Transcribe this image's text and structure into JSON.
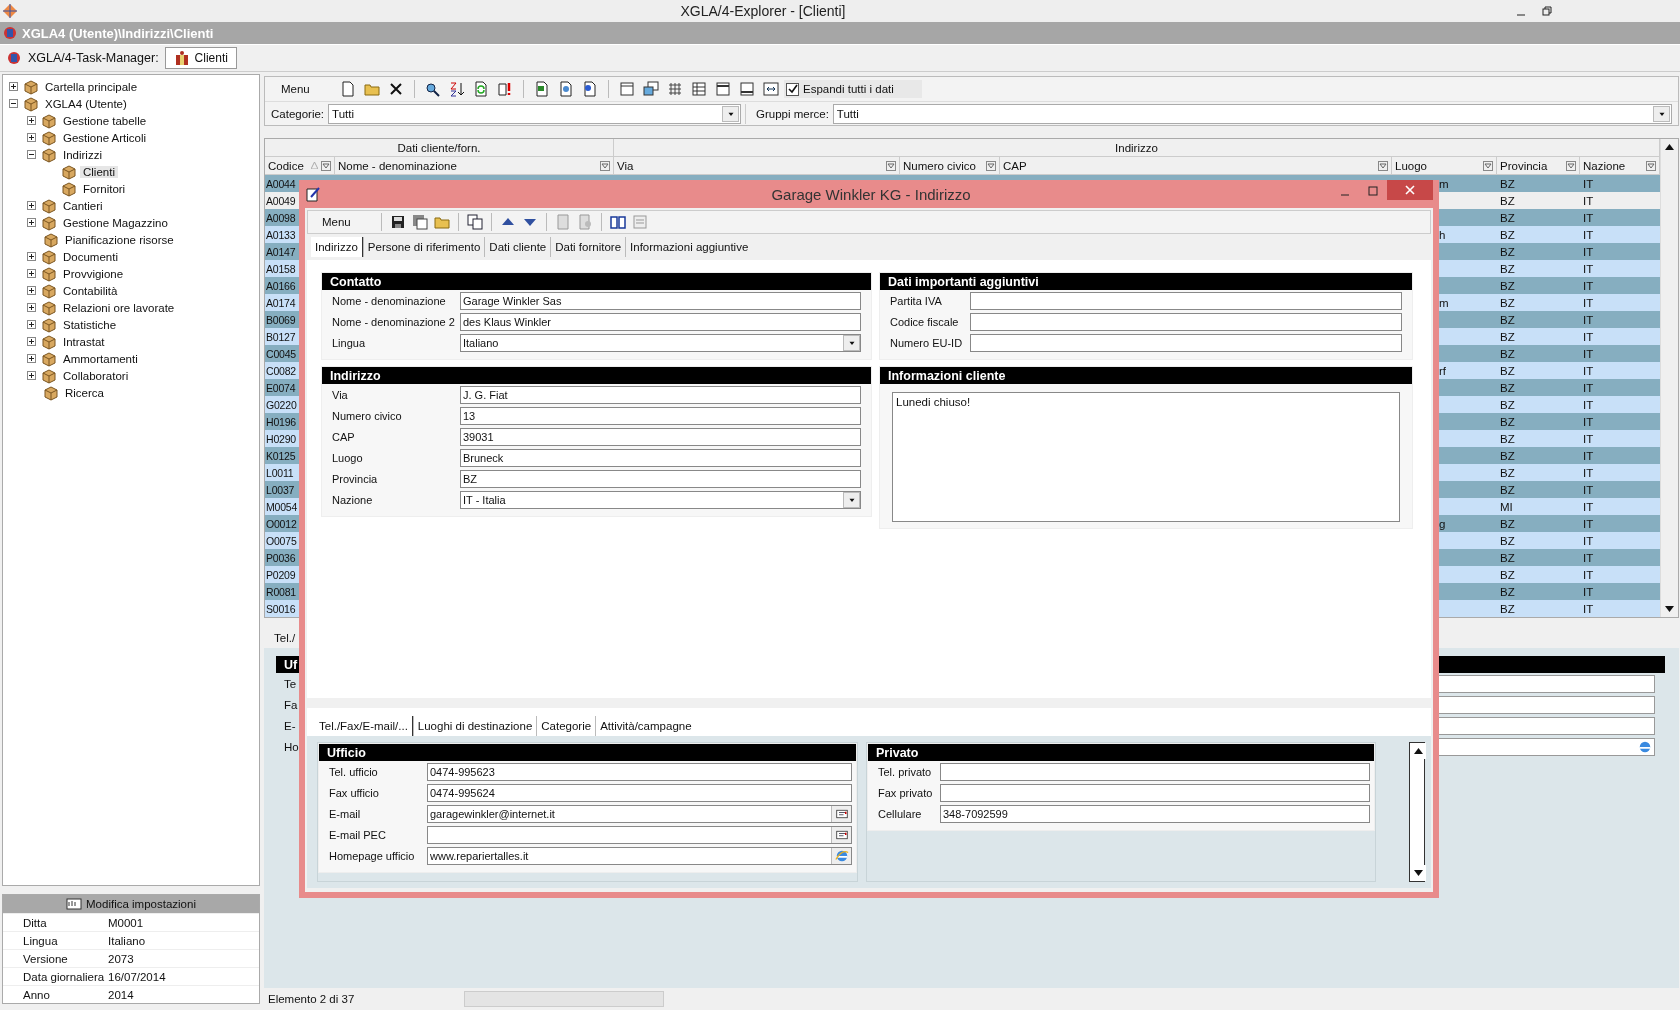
{
  "app_title": "XGLA/4-Explorer - [Clienti]",
  "breadcrumb": "XGLA4 (Utente)\\Indirizzi\\Clienti",
  "task_manager": {
    "label": "XGLA/4-Task-Manager:",
    "tabs": [
      {
        "label": "Clienti",
        "selected": true
      }
    ]
  },
  "tree": [
    {
      "label": "Cartella principale",
      "kind": "node",
      "expanded": false,
      "selected": false
    },
    {
      "label": "XGLA4 (Utente)",
      "kind": "node",
      "expanded": true,
      "selected": false,
      "children": [
        {
          "label": "Gestione tabelle",
          "kind": "node",
          "expanded": false,
          "selected": false
        },
        {
          "label": "Gestione Articoli",
          "kind": "node",
          "expanded": false,
          "selected": false
        },
        {
          "label": "Indirizzi",
          "kind": "node",
          "expanded": true,
          "selected": false,
          "children": [
            {
              "label": "Clienti",
              "kind": "leaf",
              "selected": true
            },
            {
              "label": "Fornitori",
              "kind": "leaf",
              "selected": false
            }
          ]
        },
        {
          "label": "Cantieri",
          "kind": "node",
          "expanded": false,
          "selected": false
        },
        {
          "label": "Gestione Magazzino",
          "kind": "node",
          "expanded": false,
          "selected": false
        },
        {
          "label": "Pianificazione risorse",
          "kind": "leaf",
          "selected": false
        },
        {
          "label": "Documenti",
          "kind": "node",
          "expanded": false,
          "selected": false
        },
        {
          "label": "Provvigione",
          "kind": "node",
          "expanded": false,
          "selected": false
        },
        {
          "label": "Contabilità",
          "kind": "node",
          "expanded": false,
          "selected": false
        },
        {
          "label": "Relazioni ore lavorate",
          "kind": "node",
          "expanded": false,
          "selected": false
        },
        {
          "label": "Statistiche",
          "kind": "node",
          "expanded": false,
          "selected": false
        },
        {
          "label": "Intrastat",
          "kind": "node",
          "expanded": false,
          "selected": false
        },
        {
          "label": "Ammortamenti",
          "kind": "node",
          "expanded": false,
          "selected": false
        },
        {
          "label": "Collaboratori",
          "kind": "node",
          "expanded": false,
          "selected": false
        },
        {
          "label": "Ricerca",
          "kind": "leaf",
          "selected": false
        }
      ]
    }
  ],
  "settings": {
    "title": "Modifica impostazioni",
    "rows": [
      {
        "label": "Ditta",
        "value": "M0001"
      },
      {
        "label": "Lingua",
        "value": "Italiano"
      },
      {
        "label": "Versione",
        "value": "2073"
      },
      {
        "label": "Data giornaliera",
        "value": "16/07/2014"
      },
      {
        "label": "Anno",
        "value": "2014"
      }
    ]
  },
  "toolbar": {
    "menu": "Menu",
    "expand_all": {
      "label": "Espandi tutti i dati",
      "checked": true
    }
  },
  "filters": [
    {
      "label": "Categorie:",
      "value": "Tutti"
    },
    {
      "label": "Gruppi merce:",
      "value": "Tutti"
    }
  ],
  "table": {
    "groups": [
      "Dati cliente/forn.",
      "Indirizzo"
    ],
    "columns": [
      "Codice",
      "Nome - denominazione",
      "Via",
      "Numero civico",
      "CAP",
      "Luogo",
      "Provincia",
      "Nazione"
    ],
    "rows": [
      {
        "code": "A0044",
        "luogo": "m",
        "provincia": "BZ",
        "nazione": "IT",
        "selected": false
      },
      {
        "code": "A0049",
        "provincia": "BZ",
        "nazione": "IT",
        "selected": true
      },
      {
        "code": "A0098",
        "provincia": "BZ",
        "nazione": "IT",
        "selected": false
      },
      {
        "code": "A0133",
        "luogo": "h",
        "provincia": "BZ",
        "nazione": "IT",
        "selected": false
      },
      {
        "code": "A0147",
        "provincia": "BZ",
        "nazione": "IT",
        "selected": false
      },
      {
        "code": "A0158",
        "provincia": "BZ",
        "nazione": "IT",
        "selected": false
      },
      {
        "code": "A0166",
        "provincia": "BZ",
        "nazione": "IT",
        "selected": false
      },
      {
        "code": "A0174",
        "luogo": "m",
        "provincia": "BZ",
        "nazione": "IT",
        "selected": false
      },
      {
        "code": "B0069",
        "provincia": "BZ",
        "nazione": "IT",
        "selected": false
      },
      {
        "code": "B0127",
        "provincia": "BZ",
        "nazione": "IT",
        "selected": false
      },
      {
        "code": "C0045",
        "provincia": "BZ",
        "nazione": "IT",
        "selected": false
      },
      {
        "code": "C0082",
        "luogo": "rf",
        "provincia": "BZ",
        "nazione": "IT",
        "selected": false
      },
      {
        "code": "E0074",
        "provincia": "BZ",
        "nazione": "IT",
        "selected": false
      },
      {
        "code": "G0220",
        "provincia": "BZ",
        "nazione": "IT",
        "selected": false
      },
      {
        "code": "H0196",
        "provincia": "BZ",
        "nazione": "IT",
        "selected": false
      },
      {
        "code": "H0290",
        "provincia": "BZ",
        "nazione": "IT",
        "selected": false
      },
      {
        "code": "K0125",
        "provincia": "BZ",
        "nazione": "IT",
        "selected": false
      },
      {
        "code": "L0011",
        "provincia": "BZ",
        "nazione": "IT",
        "selected": false
      },
      {
        "code": "L0037",
        "provincia": "BZ",
        "nazione": "IT",
        "selected": false
      },
      {
        "code": "M0054",
        "provincia": "MI",
        "nazione": "IT",
        "selected": false
      },
      {
        "code": "O0012",
        "luogo": "g",
        "provincia": "BZ",
        "nazione": "IT",
        "selected": false
      },
      {
        "code": "O0075",
        "provincia": "BZ",
        "nazione": "IT",
        "selected": false
      },
      {
        "code": "P0036",
        "provincia": "BZ",
        "nazione": "IT",
        "selected": false
      },
      {
        "code": "P0209",
        "provincia": "BZ",
        "nazione": "IT",
        "selected": false
      },
      {
        "code": "R0081",
        "provincia": "BZ",
        "nazione": "IT",
        "selected": false
      },
      {
        "code": "S0016",
        "provincia": "BZ",
        "nazione": "IT",
        "selected": false
      }
    ]
  },
  "detail_behind": {
    "tab": "Tel./",
    "section": "Uf",
    "labels": [
      "Te",
      "Fa",
      "E-",
      "Ho"
    ]
  },
  "status_bar": "Elemento 2 di 37",
  "dialog": {
    "title": "Garage Winkler KG - Indirizzo",
    "menu": "Menu",
    "tabs": [
      {
        "label": "Indirizzo",
        "selected": true
      },
      {
        "label": "Persone di riferimento",
        "selected": false
      },
      {
        "label": "Dati cliente",
        "selected": false
      },
      {
        "label": "Dati fornitore",
        "selected": false
      },
      {
        "label": "Informazioni aggiuntive",
        "selected": false
      }
    ],
    "left": [
      {
        "title": "Contatto",
        "fields": [
          {
            "label": "Nome - denominazione",
            "value": "Garage Winkler Sas",
            "kind": "text"
          },
          {
            "label": "Nome - denominazione 2",
            "value": "des Klaus Winkler",
            "kind": "text"
          },
          {
            "label": "Lingua",
            "value": "Italiano",
            "kind": "dropdown"
          }
        ]
      },
      {
        "title": "Indirizzo",
        "fields": [
          {
            "label": "Via",
            "value": "J. G. Fiat",
            "kind": "text"
          },
          {
            "label": "Numero civico",
            "value": "13",
            "kind": "text"
          },
          {
            "label": "CAP",
            "value": "39031",
            "kind": "text"
          },
          {
            "label": "Luogo",
            "value": "Bruneck",
            "kind": "text"
          },
          {
            "label": "Provincia",
            "value": "BZ",
            "kind": "text"
          },
          {
            "label": "Nazione",
            "value": "IT - Italia",
            "kind": "dropdown"
          }
        ]
      }
    ],
    "right": [
      {
        "title": "Dati importanti aggiuntivi",
        "fields": [
          {
            "label": "Partita IVA",
            "kind": "text"
          },
          {
            "label": "Codice fiscale",
            "kind": "text"
          },
          {
            "label": "Numero EU-ID",
            "kind": "text"
          }
        ]
      },
      {
        "title": "Informazioni cliente",
        "notes": "Lunedi chiuso!"
      }
    ],
    "lower_tabs": [
      {
        "label": "Tel./Fax/E-mail/...",
        "selected": true
      },
      {
        "label": "Luoghi di destinazione",
        "selected": false
      },
      {
        "label": "Categorie",
        "selected": false
      },
      {
        "label": "Attività/campagne",
        "selected": false
      }
    ],
    "lower_left": {
      "title": "Ufficio",
      "fields": [
        {
          "label": "Tel. ufficio",
          "value": "0474-995623",
          "kind": "text"
        },
        {
          "label": "Fax ufficio",
          "value": "0474-995624",
          "kind": "text"
        },
        {
          "label": "E-mail",
          "value": "garagewinkler@internet.it",
          "kind": "mail"
        },
        {
          "label": "E-mail PEC",
          "kind": "mail"
        },
        {
          "label": "Homepage ufficio",
          "value": "www.repariertalles.it",
          "kind": "web"
        }
      ]
    },
    "lower_right": {
      "title": "Privato",
      "fields": [
        {
          "label": "Tel. privato",
          "kind": "text"
        },
        {
          "label": "Fax privato",
          "kind": "text"
        },
        {
          "label": "Cellulare",
          "value": "348-7092599",
          "kind": "text"
        }
      ]
    }
  }
}
